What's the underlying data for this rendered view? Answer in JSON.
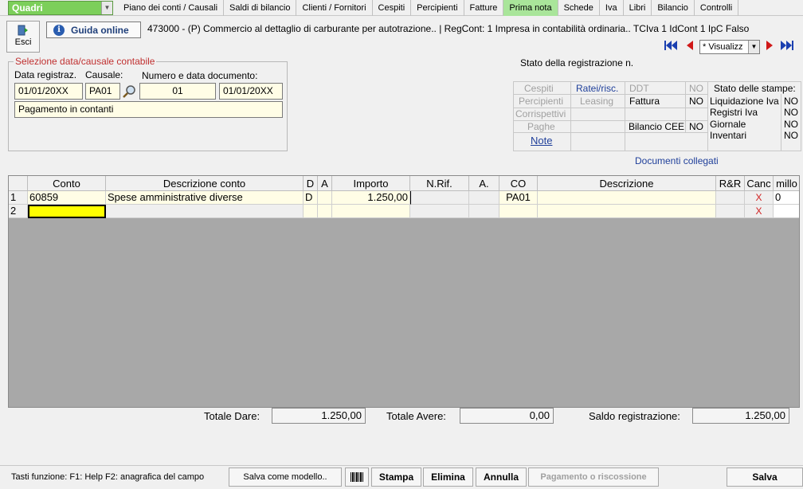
{
  "topbar": {
    "quadri": "Quadri",
    "menu": [
      "Piano dei conti / Causali",
      "Saldi di bilancio",
      "Clienti / Fornitori",
      "Cespiti",
      "Percipienti",
      "Fatture",
      "Prima nota",
      "Schede",
      "Iva",
      "Libri",
      "Bilancio",
      "Controlli"
    ],
    "active_menu": "Prima nota"
  },
  "toolbar": {
    "esci": "Esci",
    "guida": "Guida online",
    "header_info": "473000 - (P) Commercio al dettaglio di carburante per autotrazione.. | RegCont: 1 Impresa  in contabilità ordinaria..  TCIva 1 IdCont 1 IpC Falso",
    "visualizza": "* Visualizz"
  },
  "selezione": {
    "legend": "Selezione data/causale contabile",
    "data_registraz_label": "Data registraz.",
    "causale_label": "Causale:",
    "numero_data_label": "Numero e data documento:",
    "data_registraz": "01/01/20XX",
    "causale": "PA01",
    "numero": "01",
    "data_documento": "01/01/20XX",
    "descrizione_causale": "Pagamento in contanti"
  },
  "stato": {
    "title": "Stato della registrazione n.",
    "cespiti": "Cespiti",
    "ratei": "Ratei/risc.",
    "ddt": "DDT",
    "ddt_val": "NO",
    "percipienti": "Percipienti",
    "leasing": "Leasing",
    "fattura": "Fattura",
    "fattura_val": "NO",
    "corrispettivi": "Corrispettivi",
    "paghe": "Paghe",
    "bilancio_cee": "Bilancio CEE",
    "bilancio_cee_val": "NO",
    "note": "Note",
    "stampe_title": "Stato delle stampe:",
    "stampe": [
      {
        "label": "Liquidazione Iva",
        "value": "NO"
      },
      {
        "label": "Registri Iva",
        "value": "NO"
      },
      {
        "label": "Giornale",
        "value": "NO"
      },
      {
        "label": "Inventari",
        "value": "NO"
      }
    ]
  },
  "documenti_collegati": "Documenti collegati",
  "grid": {
    "headers": [
      "Conto",
      "Descrizione conto",
      "D",
      "A",
      "Importo",
      "N.Rif.",
      "A.",
      "CO",
      "Descrizione",
      "R&R",
      "Canc",
      "millo"
    ],
    "rows": [
      {
        "n": "1",
        "conto": "60859",
        "descrizione_conto": "Spese amministrative diverse",
        "d": "D",
        "a": "",
        "importo": "1.250,00",
        "nrif": "",
        "a2": "",
        "co": "PA01",
        "descrizione": "",
        "rr": "",
        "canc": "X",
        "millo": "0"
      },
      {
        "n": "2",
        "conto": "",
        "descrizione_conto": "",
        "d": "",
        "a": "",
        "importo": "",
        "nrif": "",
        "a2": "",
        "co": "",
        "descrizione": "",
        "rr": "",
        "canc": "X",
        "millo": ""
      }
    ]
  },
  "totali": {
    "dare_label": "Totale Dare:",
    "dare": "1.250,00",
    "avere_label": "Totale Avere:",
    "avere": "0,00",
    "saldo_label": "Saldo registrazione:",
    "saldo": "1.250,00"
  },
  "bottom": {
    "tasti": "Tasti funzione:  F1: Help  F2: anagrafica del campo",
    "salva_modello": "Salva come modello..",
    "stampa": "Stampa",
    "elimina": "Elimina",
    "annulla": "Annulla",
    "pagamento": "Pagamento o riscossione",
    "salva": "Salva"
  },
  "colors": {
    "quadri_bg": "#7ccf5a",
    "active_tab": "#a9e59a",
    "legend_red": "#c03030",
    "link_blue": "#1f3f9a",
    "grid_bg": "#a8a8a8",
    "input_bg": "#fffde6",
    "selected_cell": "#ffff00"
  }
}
